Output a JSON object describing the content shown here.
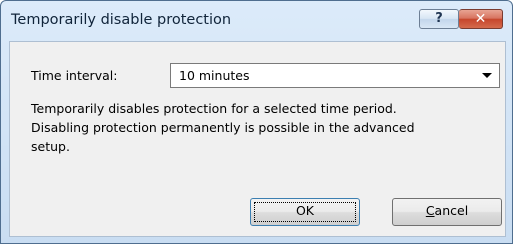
{
  "window": {
    "title": "Temporarily disable protection",
    "help_icon": "?",
    "close_icon": "✕"
  },
  "form": {
    "time_interval_label": "Time interval:",
    "time_interval_value": "10 minutes",
    "description_line1": "Temporarily disables protection for a selected time period.",
    "description_line2": "Disabling protection permanently is possible in the advanced",
    "description_line3": "setup."
  },
  "buttons": {
    "ok_label": "OK",
    "cancel_first": "C",
    "cancel_rest": "ancel"
  },
  "icons": {
    "dropdown": "chevron-down-icon",
    "help": "help-icon",
    "close": "close-icon"
  },
  "colors": {
    "titlebar": "#c9ddf2",
    "close_button": "#c6462c",
    "client_background": "#f0f0f0",
    "ok_border": "#3c7fb1"
  }
}
